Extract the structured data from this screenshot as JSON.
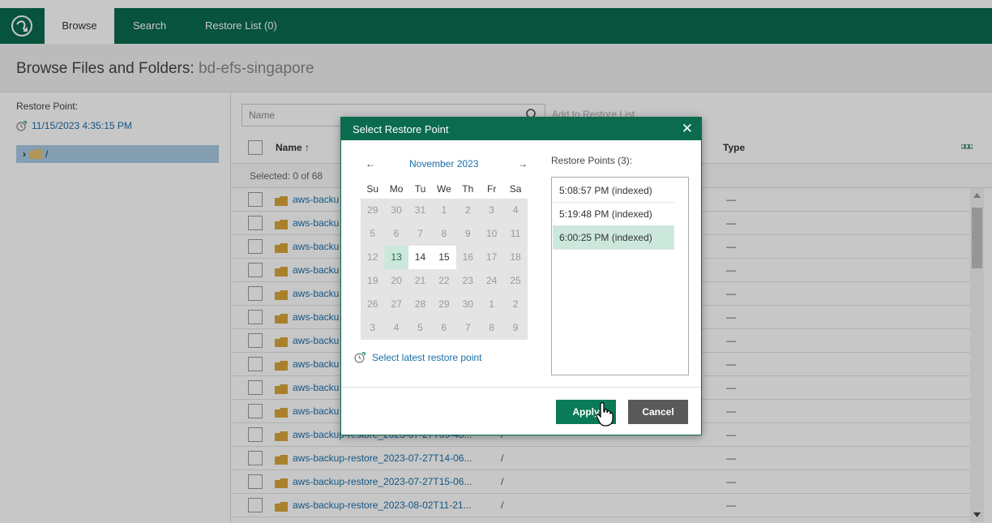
{
  "nav": {
    "tabs": [
      {
        "label": "Browse",
        "active": true
      },
      {
        "label": "Search",
        "active": false
      },
      {
        "label": "Restore List (0)",
        "active": false
      }
    ]
  },
  "title": {
    "prefix": "Browse Files and Folders:",
    "name": "bd-efs-singapore"
  },
  "left_panel": {
    "restore_point_label": "Restore Point:",
    "restore_point_value": "11/15/2023 4:35:15 PM",
    "tree_root": "/"
  },
  "toolbar": {
    "search_placeholder": "Name",
    "add_to_restore_list": "Add to Restore List"
  },
  "table": {
    "col_name": "Name ↑",
    "col_type": "Type",
    "selected_text": "Selected: 0 of 68",
    "rows": [
      {
        "name": "aws-backu",
        "path": "",
        "type": "—"
      },
      {
        "name": "aws-backu",
        "path": "",
        "type": "—"
      },
      {
        "name": "aws-backu",
        "path": "",
        "type": "—"
      },
      {
        "name": "aws-backu",
        "path": "",
        "type": "—"
      },
      {
        "name": "aws-backu",
        "path": "",
        "type": "—"
      },
      {
        "name": "aws-backu",
        "path": "",
        "type": "—"
      },
      {
        "name": "aws-backu",
        "path": "",
        "type": "—"
      },
      {
        "name": "aws-backu",
        "path": "",
        "type": "—"
      },
      {
        "name": "aws-backu",
        "path": "",
        "type": "—"
      },
      {
        "name": "aws-backu",
        "path": "",
        "type": "—"
      },
      {
        "name": "aws-backup-restore_2023-07-27T09-48...",
        "path": "/",
        "type": "—"
      },
      {
        "name": "aws-backup-restore_2023-07-27T14-06...",
        "path": "/",
        "type": "—"
      },
      {
        "name": "aws-backup-restore_2023-07-27T15-06...",
        "path": "/",
        "type": "—"
      },
      {
        "name": "aws-backup-restore_2023-08-02T11-21...",
        "path": "/",
        "type": "—"
      }
    ]
  },
  "dialog": {
    "title": "Select Restore Point",
    "close": "✕",
    "calendar": {
      "prev": "←",
      "next": "→",
      "month": "November 2023",
      "weekdays": [
        "Su",
        "Mo",
        "Tu",
        "We",
        "Th",
        "Fr",
        "Sa"
      ],
      "weeks": [
        [
          "29",
          "30",
          "31",
          "1",
          "2",
          "3",
          "4"
        ],
        [
          "5",
          "6",
          "7",
          "8",
          "9",
          "10",
          "11"
        ],
        [
          "12",
          "13",
          "14",
          "15",
          "16",
          "17",
          "18"
        ],
        [
          "19",
          "20",
          "21",
          "22",
          "23",
          "24",
          "25"
        ],
        [
          "26",
          "27",
          "28",
          "29",
          "30",
          "1",
          "2"
        ],
        [
          "3",
          "4",
          "5",
          "6",
          "7",
          "8",
          "9"
        ]
      ],
      "selected_day": "13",
      "available_days": [
        "14",
        "15"
      ]
    },
    "latest_link": "Select latest restore point",
    "restore_points_title": "Restore Points (3):",
    "restore_points": [
      {
        "label": "5:08:57 PM (indexed)",
        "selected": false
      },
      {
        "label": "5:19:48 PM (indexed)",
        "selected": false
      },
      {
        "label": "6:00:25 PM (indexed)",
        "selected": true
      }
    ],
    "apply": "Apply",
    "cancel": "Cancel"
  },
  "colors": {
    "brand_green": "#0a6b4f",
    "link_blue": "#1a6fa8",
    "selection_green": "#cce8dc",
    "folder": "#d9a63a"
  }
}
